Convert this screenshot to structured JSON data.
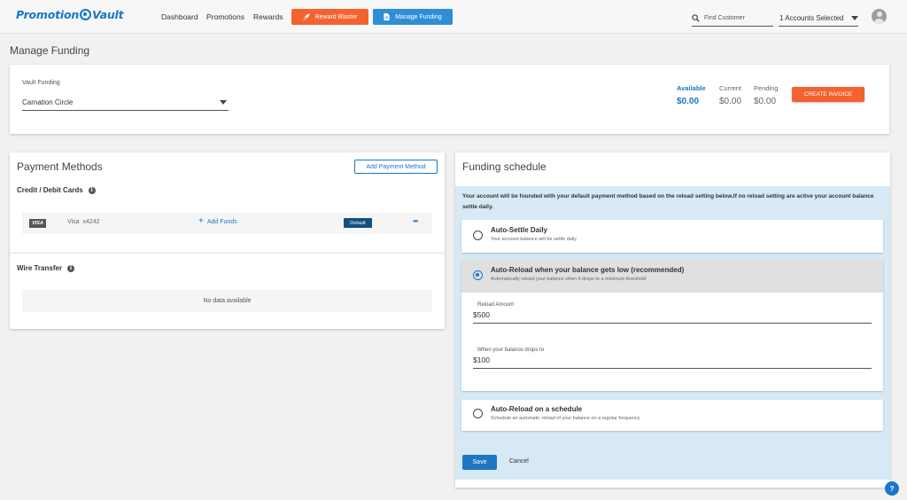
{
  "header": {
    "logo_text": "Promotion Vault",
    "logo_left": "Promotion",
    "logo_right": "Vault",
    "nav": [
      "Dashboard",
      "Promotions",
      "Rewards"
    ],
    "reward_blaster_label": "Reward Blaster",
    "manage_funding_label": "Manage Funding",
    "find_placeholder": "Find Customer",
    "accounts_label": "1 Accounts Selected"
  },
  "page": {
    "title": "Manage Funding"
  },
  "vault": {
    "label": "Vault Funding",
    "selected": "Carnation Circle",
    "available_label": "Available",
    "available_value": "$0.00",
    "current_label": "Current",
    "current_value": "$0.00",
    "pending_label": "Pending",
    "pending_value": "$0.00",
    "create_invoice_label": "CREATE INVOICE"
  },
  "payment_methods": {
    "title": "Payment Methods",
    "add_label": "Add Payment Method",
    "cards_heading": "Credit / Debit Cards",
    "card": {
      "brand": "VISA",
      "name": "Visa  x4242",
      "add_funds": "Add Funds",
      "badge": "Default",
      "more": "•••"
    },
    "wire_heading": "Wire Transfer",
    "no_data": "No data available"
  },
  "schedule": {
    "title": "Funding schedule",
    "notice": "Your account will be founded with your default payment method based on the reload setting below.If no reload setting are active your account balance settle daily.",
    "options": [
      {
        "title": "Auto-Settle Daily",
        "desc": "Your account balance will be settle daily"
      },
      {
        "title": "Auto-Reload when your balance gets low (recommended)",
        "desc": "Automatically reload your balance when it drops to a minimum threshold"
      },
      {
        "title": "Auto-Reload on a schedule",
        "desc": "Schedule an automatic reload of your balance on a regular frequency"
      }
    ],
    "reload_amount_label": "Reload Amount",
    "reload_amount_prefix": "$",
    "reload_amount_value": "500",
    "threshold_label": "When your balance drops to",
    "threshold_prefix": "$",
    "threshold_value": "100",
    "save_label": "Save",
    "cancel_label": "Cancel"
  },
  "help": {
    "label": "?"
  },
  "colors": {
    "brand_blue": "#1976c9",
    "orange": "#f4622f",
    "notice_bg": "#d6e9f5",
    "save_blue": "#1f77c4"
  }
}
